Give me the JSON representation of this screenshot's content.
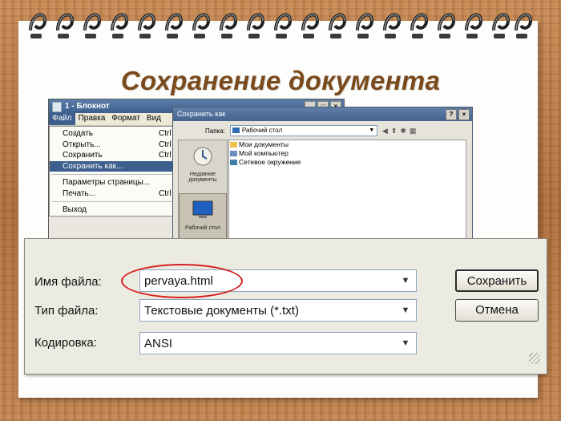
{
  "slide": {
    "title": "Сохранение документа"
  },
  "notepad": {
    "title": "1 - Блокнот",
    "menubar": [
      "Файл",
      "Правка",
      "Формат",
      "Вид"
    ],
    "file_menu": [
      {
        "label": "Создать",
        "shortcut": "Ctrl"
      },
      {
        "label": "Открыть...",
        "shortcut": "Ctrl"
      },
      {
        "label": "Сохранить",
        "shortcut": "Ctrl"
      },
      {
        "label": "Сохранить как...",
        "shortcut": ""
      },
      {
        "label": "Параметры страницы...",
        "shortcut": ""
      },
      {
        "label": "Печать...",
        "shortcut": "Ctrl"
      },
      {
        "label": "Выход",
        "shortcut": ""
      }
    ]
  },
  "save_dialog": {
    "title": "Сохранить как",
    "folder_label": "Папка:",
    "folder_value": "Рабочий стол",
    "places": [
      {
        "label": "Недавние документы",
        "icon": "recent-documents-icon"
      },
      {
        "label": "Рабочий стол",
        "icon": "desktop-icon"
      }
    ],
    "list_items": [
      {
        "label": "Мои документы",
        "icon": "folder-icon"
      },
      {
        "label": "Мой компьютер",
        "icon": "computer-icon"
      },
      {
        "label": "Сетевое окружение",
        "icon": "network-icon"
      }
    ]
  },
  "bottom_panel": {
    "filename_label": "Имя файла:",
    "filename_value": "pervaya.html",
    "filetype_label": "Тип файла:",
    "filetype_value": "Текстовые документы (*.txt)",
    "encoding_label": "Кодировка:",
    "encoding_value": "ANSI",
    "save_button": "Сохранить",
    "cancel_button": "Отмена"
  },
  "colors": {
    "highlight_oval": "#d81f1f",
    "title_text": "#7a4a1c",
    "selection": "#3c5f8e"
  }
}
